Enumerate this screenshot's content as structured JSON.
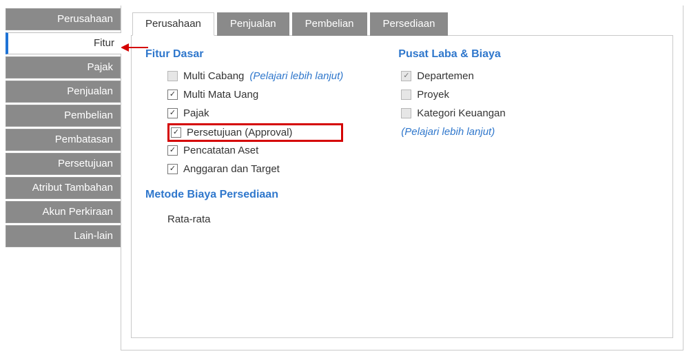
{
  "sidebar": {
    "items": [
      {
        "label": "Perusahaan"
      },
      {
        "label": "Fitur"
      },
      {
        "label": "Pajak"
      },
      {
        "label": "Penjualan"
      },
      {
        "label": "Pembelian"
      },
      {
        "label": "Pembatasan"
      },
      {
        "label": "Persetujuan"
      },
      {
        "label": "Atribut Tambahan"
      },
      {
        "label": "Akun Perkiraan"
      },
      {
        "label": "Lain-lain"
      }
    ],
    "selected_index": 1
  },
  "tabs": {
    "items": [
      {
        "label": "Perusahaan"
      },
      {
        "label": "Penjualan"
      },
      {
        "label": "Pembelian"
      },
      {
        "label": "Persediaan"
      }
    ],
    "active_index": 0
  },
  "sections": {
    "fitur_dasar": {
      "title": "Fitur Dasar",
      "items": [
        {
          "label": "Multi Cabang",
          "checked": false,
          "disabled": true,
          "link": "(Pelajari lebih lanjut)"
        },
        {
          "label": "Multi Mata Uang",
          "checked": true,
          "disabled": false
        },
        {
          "label": "Pajak",
          "checked": true,
          "disabled": false
        },
        {
          "label": "Persetujuan (Approval)",
          "checked": true,
          "disabled": false,
          "highlighted": true
        },
        {
          "label": "Pencatatan Aset",
          "checked": true,
          "disabled": false
        },
        {
          "label": "Anggaran dan Target",
          "checked": true,
          "disabled": false
        }
      ]
    },
    "metode_biaya_persediaan": {
      "title": "Metode Biaya Persediaan",
      "value": "Rata-rata"
    },
    "pusat_laba_biaya": {
      "title": "Pusat Laba & Biaya",
      "items": [
        {
          "label": "Departemen",
          "checked": true,
          "disabled": true
        },
        {
          "label": "Proyek",
          "checked": false,
          "disabled": true
        },
        {
          "label": "Kategori Keuangan",
          "checked": false,
          "disabled": true
        }
      ],
      "link": "(Pelajari lebih lanjut)"
    }
  }
}
